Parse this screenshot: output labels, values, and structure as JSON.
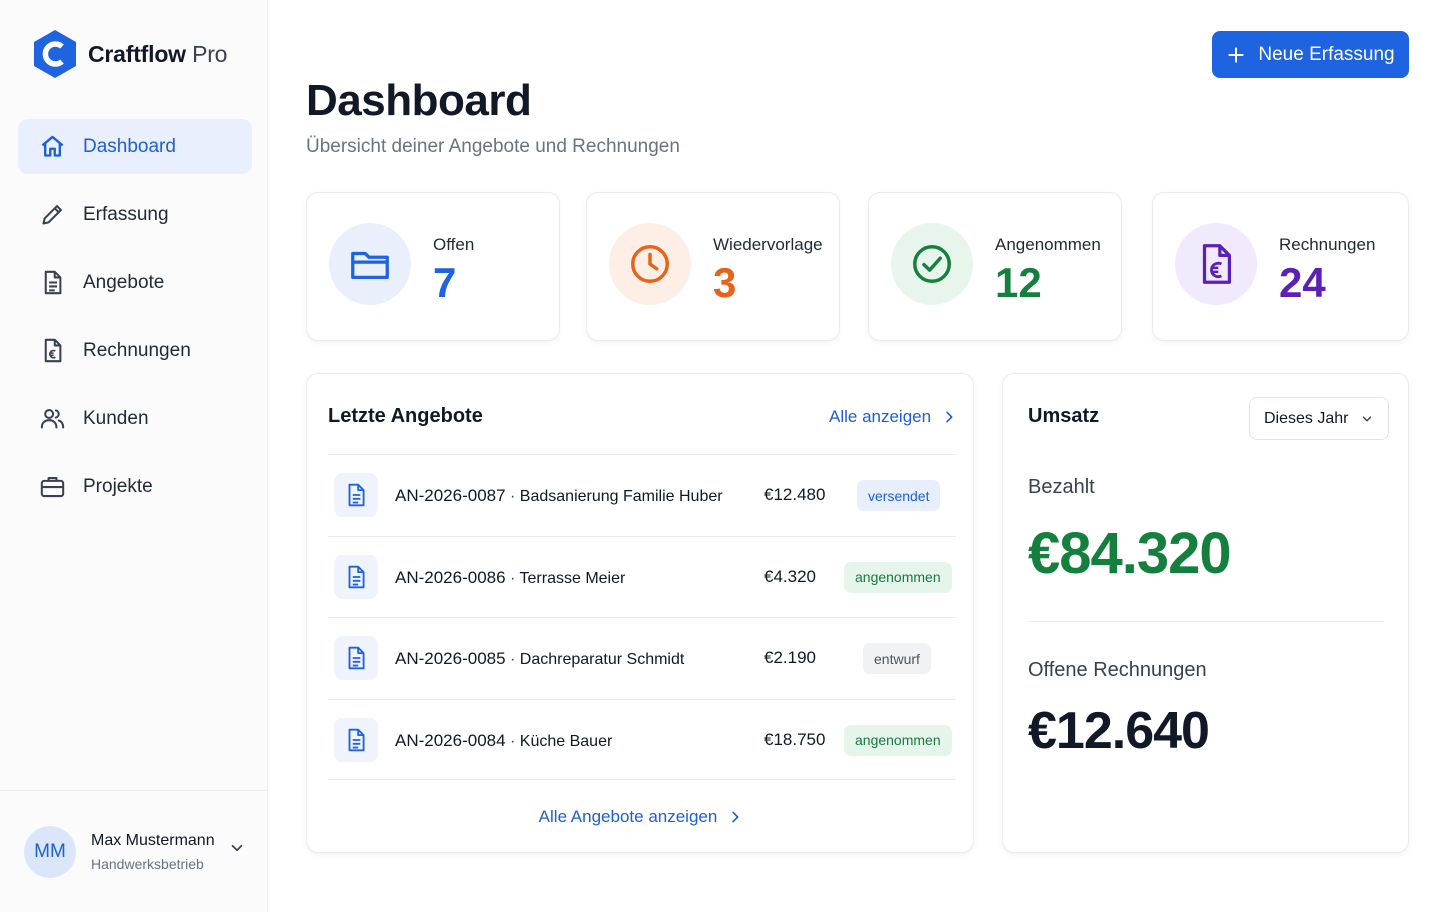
{
  "brand": {
    "name": "Craftflow",
    "suffix": "Pro"
  },
  "nav": [
    {
      "label": "Dashboard",
      "icon": "home-icon",
      "active": true
    },
    {
      "label": "Erfassung",
      "icon": "pencil-icon"
    },
    {
      "label": "Angebote",
      "icon": "document-icon"
    },
    {
      "label": "Rechnungen",
      "icon": "invoice-euro-icon"
    },
    {
      "label": "Kunden",
      "icon": "users-icon"
    },
    {
      "label": "Projekte",
      "icon": "briefcase-icon"
    }
  ],
  "user": {
    "initials": "MM",
    "name": "Max Mustermann",
    "role": "Handwerksbetrieb"
  },
  "header": {
    "title": "Dashboard",
    "subtitle": "Übersicht deiner Angebote und Rechnungen",
    "new_button": "Neue Erfassung"
  },
  "stats": [
    {
      "label": "Offen",
      "value": "7",
      "icon": "folder-icon",
      "color": "#1e63e0",
      "bg": "#e9f0fc"
    },
    {
      "label": "Wiedervorlage",
      "value": "3",
      "icon": "clock-icon",
      "color": "#e8621b",
      "bg": "#fdeee6"
    },
    {
      "label": "Angenommen",
      "value": "12",
      "icon": "check-circle-icon",
      "color": "#15803d",
      "bg": "#e7f5ec"
    },
    {
      "label": "Rechnungen",
      "value": "24",
      "icon": "invoice-euro-icon",
      "color": "#5b21b6",
      "bg": "#f0eafc"
    }
  ],
  "offers": {
    "title": "Letzte Angebote",
    "view_all": "Alle anzeigen",
    "footer_link": "Alle Angebote anzeigen",
    "rows": [
      {
        "number": "AN-2026-0087",
        "project": "Badsanierung Familie Huber",
        "amount": "€12.480",
        "status": "versendet",
        "status_type": "sent"
      },
      {
        "number": "AN-2026-0086",
        "project": "Terrasse Meier",
        "amount": "€4.320",
        "status": "angenommen",
        "status_type": "accepted"
      },
      {
        "number": "AN-2026-0085",
        "project": "Dachreparatur Schmidt",
        "amount": "€2.190",
        "status": "entwurf",
        "status_type": "draft"
      },
      {
        "number": "AN-2026-0084",
        "project": "Küche Bauer",
        "amount": "€18.750",
        "status": "angenommen",
        "status_type": "accepted"
      }
    ]
  },
  "revenue": {
    "title": "Umsatz",
    "period": "Dieses Jahr",
    "paid_label": "Bezahlt",
    "paid_value": "€84.320",
    "open_label": "Offene Rechnungen",
    "open_value": "€12.640",
    "paid_color": "#15803d"
  }
}
